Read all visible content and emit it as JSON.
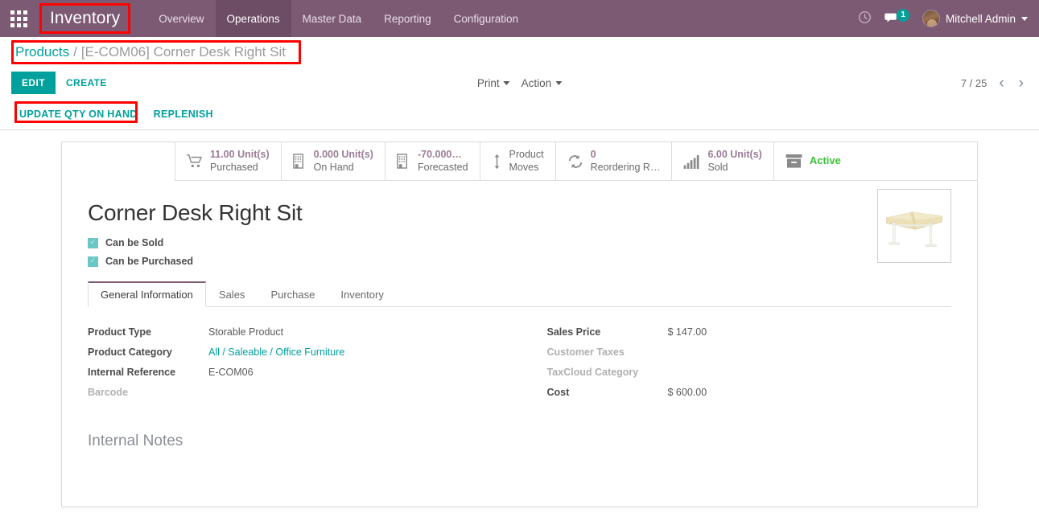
{
  "navbar": {
    "apps_icon": "apps-grid-icon",
    "brand": "Inventory",
    "menu": [
      {
        "label": "Overview",
        "active": false
      },
      {
        "label": "Operations",
        "active": true
      },
      {
        "label": "Master Data",
        "active": false
      },
      {
        "label": "Reporting",
        "active": false
      },
      {
        "label": "Configuration",
        "active": false
      }
    ],
    "activity_icon": "clock-icon",
    "messages_icon": "chat-bubble-icon",
    "messages_badge": "1",
    "user_name": "Mitchell Admin",
    "avatar_icon": "user-avatar",
    "brand_color": "#7d5a74",
    "accent_color": "#00a09d",
    "badge_color": "#00a09d"
  },
  "breadcrumb": {
    "root": "Products",
    "separator": "/",
    "current": "[E-COM06] Corner Desk Right Sit",
    "annotation_color": "#ff0000"
  },
  "control_panel": {
    "edit_label": "EDIT",
    "create_label": "CREATE",
    "print_label": "Print",
    "action_label": "Action",
    "pager_text": "7 / 25",
    "pager_prev_icon": "chevron-left-icon",
    "pager_next_icon": "chevron-right-icon"
  },
  "action_buttons": {
    "update_qty_label": "UPDATE QTY ON HAND",
    "replenish_label": "REPLENISH"
  },
  "stat_buttons": [
    {
      "icon": "shopping-cart-icon",
      "value": "11.00 Unit(s)",
      "label": "Purchased"
    },
    {
      "icon": "warehouse-icon",
      "value": "0.000 Unit(s)",
      "label": "On Hand"
    },
    {
      "icon": "warehouse-icon",
      "value": "-70.000…",
      "label": "Forecasted"
    },
    {
      "icon": "arrows-vertical-icon",
      "value": "Product",
      "label": "Moves"
    },
    {
      "icon": "refresh-icon",
      "value": "0",
      "label": "Reordering R…"
    },
    {
      "icon": "bar-chart-icon",
      "value": "6.00 Unit(s)",
      "label": "Sold"
    },
    {
      "icon": "archive-box-icon",
      "value": "",
      "label": "Active",
      "status": true
    }
  ],
  "product": {
    "title": "Corner Desk Right Sit",
    "image_alt": "corner-desk-product-photo",
    "checkboxes": [
      {
        "label": "Can be Sold",
        "checked": true
      },
      {
        "label": "Can be Purchased",
        "checked": true
      }
    ]
  },
  "tabs": [
    {
      "label": "General Information",
      "active": true
    },
    {
      "label": "Sales",
      "active": false
    },
    {
      "label": "Purchase",
      "active": false
    },
    {
      "label": "Inventory",
      "active": false
    }
  ],
  "form": {
    "left": [
      {
        "label": "Product Type",
        "value": "Storable Product",
        "muted_label": false,
        "link": false
      },
      {
        "label": "Product Category",
        "value": "All / Saleable / Office Furniture",
        "muted_label": false,
        "link": true
      },
      {
        "label": "Internal Reference",
        "value": "E-COM06",
        "muted_label": false,
        "link": false
      },
      {
        "label": "Barcode",
        "value": "",
        "muted_label": true,
        "link": false
      }
    ],
    "right": [
      {
        "label": "Sales Price",
        "value": "$ 147.00",
        "muted_label": false,
        "link": false
      },
      {
        "label": "Customer Taxes",
        "value": "",
        "muted_label": true,
        "link": false
      },
      {
        "label": "TaxCloud Category",
        "value": "",
        "muted_label": true,
        "link": false
      },
      {
        "label": "Cost",
        "value": "$ 600.00",
        "muted_label": false,
        "link": false
      }
    ]
  },
  "notes": {
    "title": "Internal Notes"
  }
}
